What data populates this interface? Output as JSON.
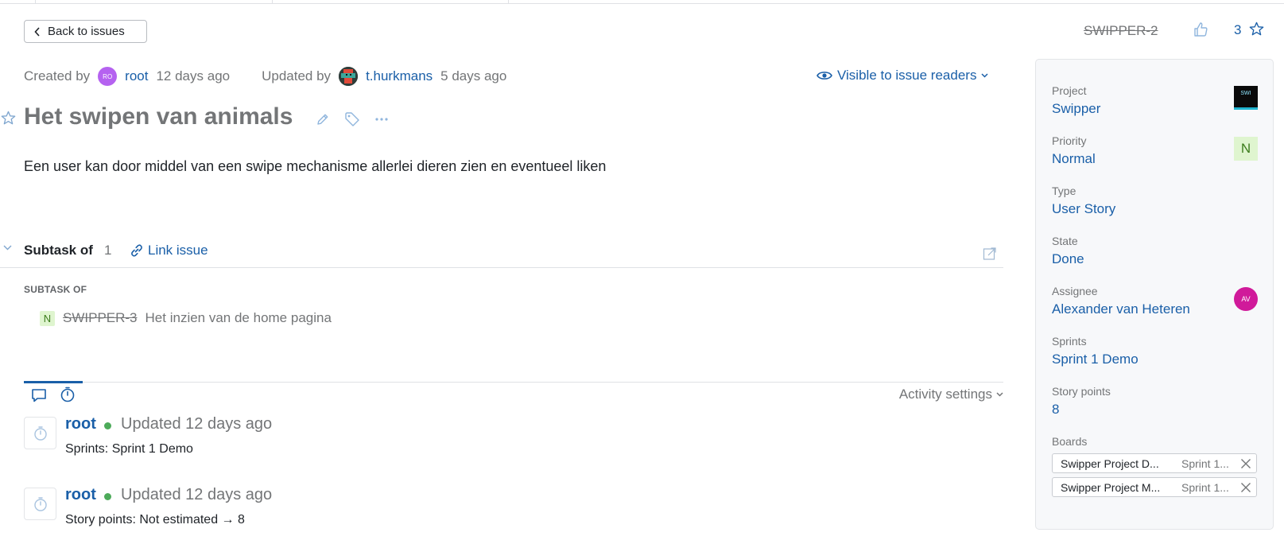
{
  "header": {
    "back_label": "Back to issues",
    "issue_id": "SWIPPER-2",
    "vote_count": "3"
  },
  "meta": {
    "created_by_label": "Created by",
    "creator_avatar": "RO",
    "creator": "root",
    "created_when": "12 days ago",
    "updated_by_label": "Updated by",
    "updater": "t.hurkmans",
    "updated_when": "5 days ago",
    "visibility": "Visible to issue readers"
  },
  "issue": {
    "title": "Het swipen van animals",
    "description": "Een user kan door middel van een swipe mechanisme allerlei dieren zien en eventueel liken"
  },
  "links": {
    "section_title": "Subtask of",
    "count": "1",
    "link_issue_label": "Link issue",
    "group_label": "SUBTASK OF",
    "items": [
      {
        "priority": "N",
        "id": "SWIPPER-3",
        "summary": "Het inzien van de home pagina"
      }
    ]
  },
  "activity": {
    "settings_label": "Activity settings",
    "entries": [
      {
        "author": "root",
        "when": "Updated 12 days ago",
        "change": "Sprints: Sprint 1 Demo"
      },
      {
        "author": "root",
        "when": "Updated 12 days ago",
        "change": "Story points: Not estimated → 8"
      }
    ]
  },
  "sidebar": {
    "project_label": "Project",
    "project": "Swipper",
    "project_logo": "SWI",
    "priority_label": "Priority",
    "priority": "Normal",
    "priority_badge": "N",
    "type_label": "Type",
    "type": "User Story",
    "state_label": "State",
    "state": "Done",
    "assignee_label": "Assignee",
    "assignee": "Alexander van Heteren",
    "assignee_avatar": "AV",
    "sprints_label": "Sprints",
    "sprints": "Sprint 1 Demo",
    "story_points_label": "Story points",
    "story_points": "8",
    "boards_label": "Boards",
    "boards": [
      {
        "name": "Swipper Project D...",
        "sprint": "Sprint 1..."
      },
      {
        "name": "Swipper Project M...",
        "sprint": "Sprint 1..."
      }
    ]
  },
  "colors": {
    "link": "#1a5fa8",
    "muted": "#737577",
    "online_dot": "#4dab5a",
    "priority_bg": "#dff5cf"
  }
}
